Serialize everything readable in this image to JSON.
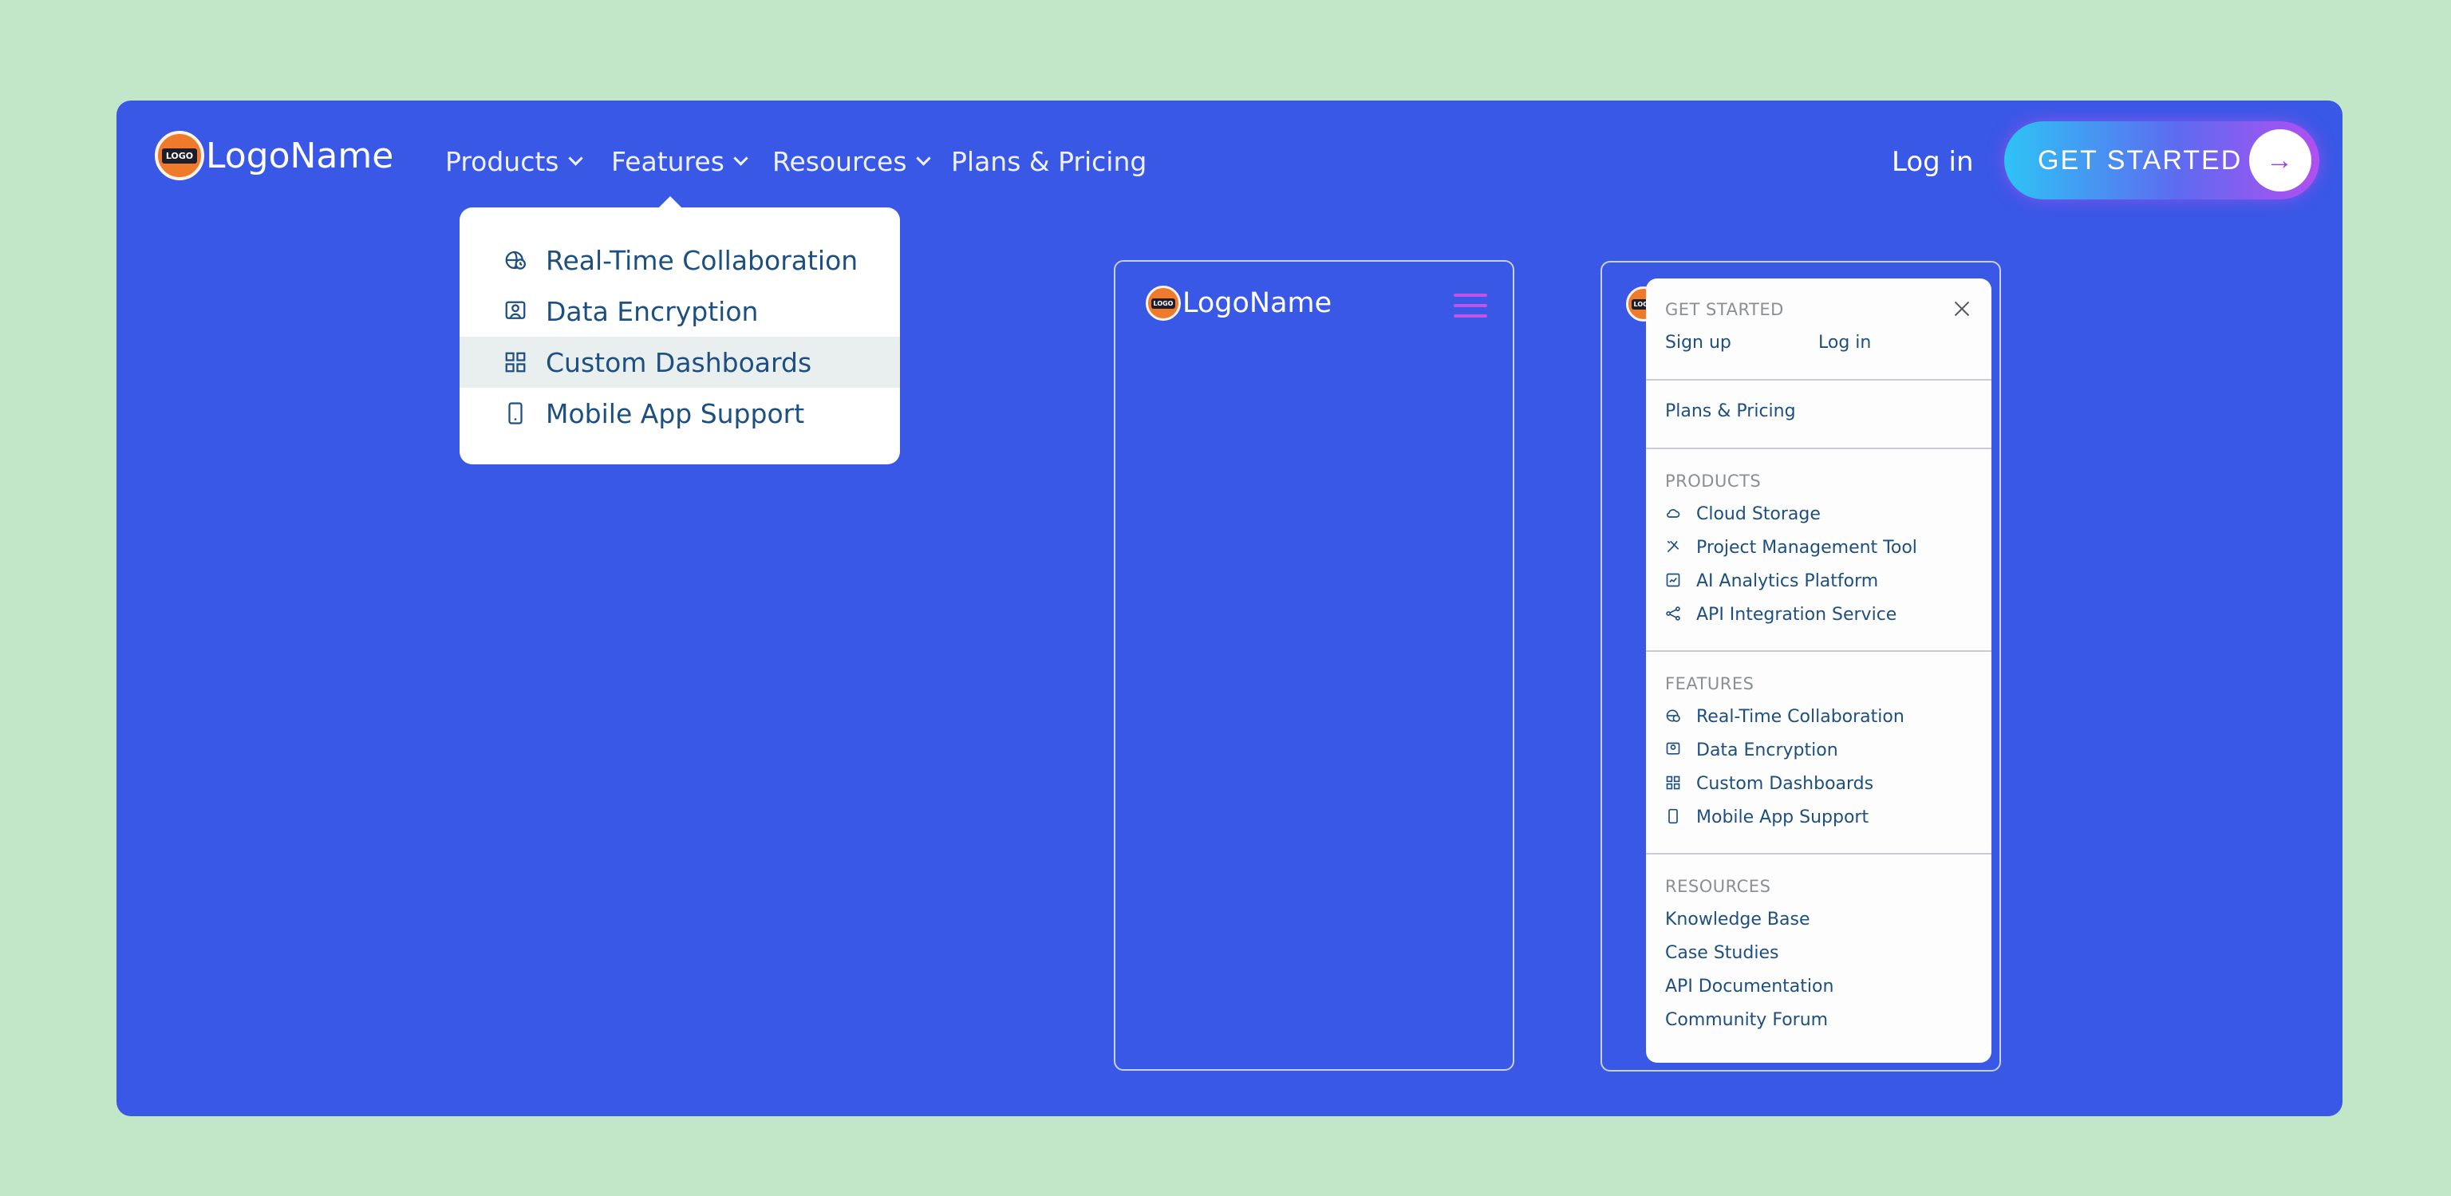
{
  "brand": {
    "name": "LogoName",
    "badge_text": "LOGO"
  },
  "nav": {
    "items": [
      {
        "label": "Products"
      },
      {
        "label": "Features"
      },
      {
        "label": "Resources"
      },
      {
        "label": "Plans & Pricing"
      }
    ],
    "login_label": "Log in",
    "cta_label": "GET STARTED"
  },
  "features_dropdown": {
    "items": [
      {
        "label": "Real-Time Collaboration",
        "icon": "globe-clock-icon"
      },
      {
        "label": "Data Encryption",
        "icon": "shield-user-icon"
      },
      {
        "label": "Custom Dashboards",
        "icon": "dashboard-grid-icon",
        "hovered": true
      },
      {
        "label": "Mobile App Support",
        "icon": "smartphone-icon"
      }
    ]
  },
  "mobile_menu": {
    "get_started_title": "GET STARTED",
    "sign_up_label": "Sign up",
    "log_in_label": "Log in",
    "plans_label": "Plans & Pricing",
    "products_title": "PRODUCTS",
    "products": [
      {
        "label": "Cloud Storage",
        "icon": "cloud-icon"
      },
      {
        "label": "Project Management Tool",
        "icon": "tools-icon"
      },
      {
        "label": "AI Analytics Platform",
        "icon": "analytics-chart-icon"
      },
      {
        "label": "API Integration Service",
        "icon": "share-nodes-icon"
      }
    ],
    "features_title": "FEATURES",
    "features": [
      {
        "label": "Real-Time Collaboration",
        "icon": "globe-clock-icon"
      },
      {
        "label": "Data Encryption",
        "icon": "shield-user-icon"
      },
      {
        "label": "Custom Dashboards",
        "icon": "dashboard-grid-icon"
      },
      {
        "label": "Mobile App Support",
        "icon": "smartphone-icon"
      }
    ],
    "resources_title": "RESOURCES",
    "resources": [
      {
        "label": "Knowledge Base"
      },
      {
        "label": "Case Studies"
      },
      {
        "label": "API Documentation"
      },
      {
        "label": "Community Forum"
      }
    ]
  },
  "colors": {
    "page_bg": "#c2e7c8",
    "frame_bg": "#3a58e6",
    "link_color": "#1d4f80",
    "hamburger": "#c153e8",
    "cta_gradient_start": "#2ec3f5",
    "cta_gradient_end": "#b14ff0"
  }
}
